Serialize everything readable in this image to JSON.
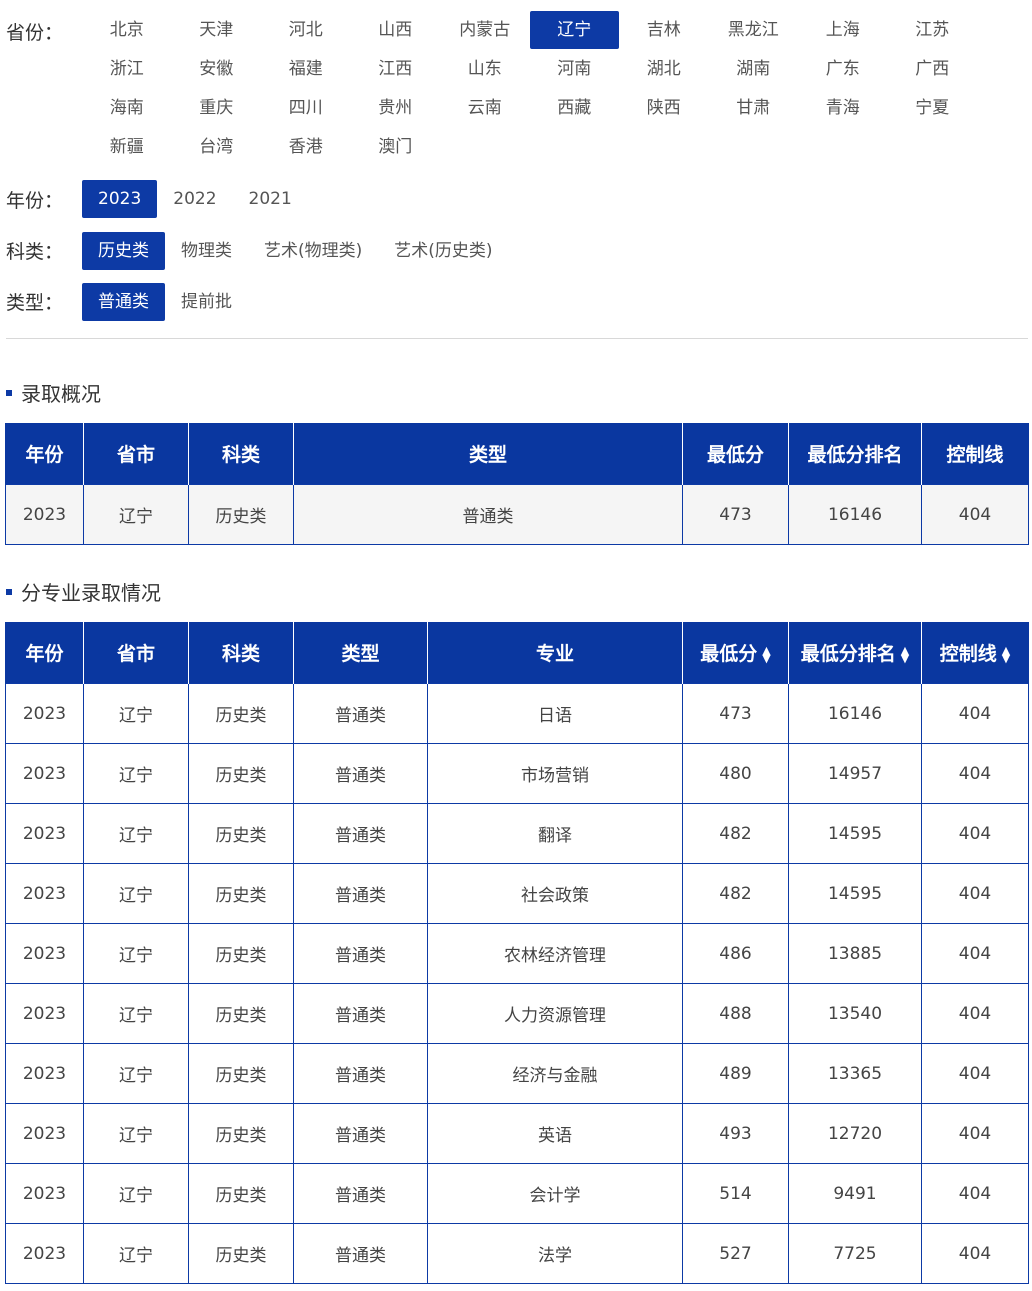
{
  "filters": {
    "province_label": "省份：",
    "year_label": "年份：",
    "subject_label": "科类：",
    "type_label": "类型：",
    "provinces": [
      "北京",
      "天津",
      "河北",
      "山西",
      "内蒙古",
      "辽宁",
      "吉林",
      "黑龙江",
      "上海",
      "江苏",
      "浙江",
      "安徽",
      "福建",
      "江西",
      "山东",
      "河南",
      "湖北",
      "湖南",
      "广东",
      "广西",
      "海南",
      "重庆",
      "四川",
      "贵州",
      "云南",
      "西藏",
      "陕西",
      "甘肃",
      "青海",
      "宁夏",
      "新疆",
      "台湾",
      "香港",
      "澳门"
    ],
    "active_province": "辽宁",
    "years": [
      "2023",
      "2022",
      "2021"
    ],
    "active_year": "2023",
    "subjects": [
      "历史类",
      "物理类",
      "艺术(物理类)",
      "艺术(历史类)"
    ],
    "active_subject": "历史类",
    "types": [
      "普通类",
      "提前批"
    ],
    "active_type": "普通类"
  },
  "overview": {
    "title": "录取概况",
    "headers": [
      "年份",
      "省市",
      "科类",
      "类型",
      "最低分",
      "最低分排名",
      "控制线"
    ],
    "rows": [
      [
        "2023",
        "辽宁",
        "历史类",
        "普通类",
        "473",
        "16146",
        "404"
      ]
    ]
  },
  "majors": {
    "title": "分专业录取情况",
    "headers": [
      "年份",
      "省市",
      "科类",
      "类型",
      "专业",
      "最低分",
      "最低分排名",
      "控制线"
    ],
    "sortable": [
      false,
      false,
      false,
      false,
      false,
      true,
      true,
      true
    ],
    "rows": [
      [
        "2023",
        "辽宁",
        "历史类",
        "普通类",
        "日语",
        "473",
        "16146",
        "404"
      ],
      [
        "2023",
        "辽宁",
        "历史类",
        "普通类",
        "市场营销",
        "480",
        "14957",
        "404"
      ],
      [
        "2023",
        "辽宁",
        "历史类",
        "普通类",
        "翻译",
        "482",
        "14595",
        "404"
      ],
      [
        "2023",
        "辽宁",
        "历史类",
        "普通类",
        "社会政策",
        "482",
        "14595",
        "404"
      ],
      [
        "2023",
        "辽宁",
        "历史类",
        "普通类",
        "农林经济管理",
        "486",
        "13885",
        "404"
      ],
      [
        "2023",
        "辽宁",
        "历史类",
        "普通类",
        "人力资源管理",
        "488",
        "13540",
        "404"
      ],
      [
        "2023",
        "辽宁",
        "历史类",
        "普通类",
        "经济与金融",
        "489",
        "13365",
        "404"
      ],
      [
        "2023",
        "辽宁",
        "历史类",
        "普通类",
        "英语",
        "493",
        "12720",
        "404"
      ],
      [
        "2023",
        "辽宁",
        "历史类",
        "普通类",
        "会计学",
        "514",
        "9491",
        "404"
      ],
      [
        "2023",
        "辽宁",
        "历史类",
        "普通类",
        "法学",
        "527",
        "7725",
        "404"
      ]
    ]
  },
  "icons": {
    "sort": "sort-updown-icon",
    "bullet": "square-bullet-icon"
  },
  "colors": {
    "accent": "#0d3aa5",
    "header_bg": "#0a37a0"
  }
}
